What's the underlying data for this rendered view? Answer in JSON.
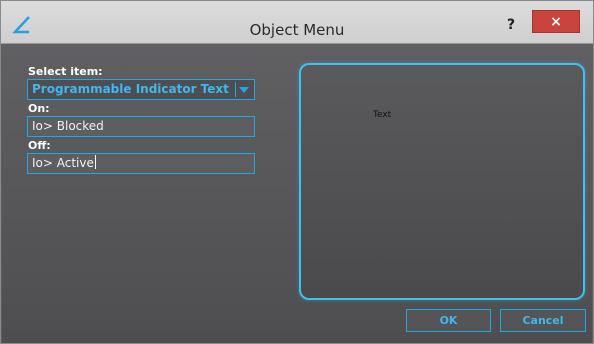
{
  "window": {
    "title": "Object Menu",
    "help_label": "?",
    "close_label": "×"
  },
  "form": {
    "select_label": "Select item:",
    "select_value": "Programmable Indicator Text",
    "on_label": "On:",
    "on_value": "Io> Blocked",
    "off_label": "Off:",
    "off_value": "Io> Active"
  },
  "preview": {
    "text": "Text"
  },
  "buttons": {
    "ok": "OK",
    "cancel": "Cancel"
  },
  "colors": {
    "accent": "#1da8e8",
    "close": "#c9443d"
  },
  "icons": {
    "app": "triangle-logo-icon",
    "dropdown": "chevron-down-icon"
  }
}
